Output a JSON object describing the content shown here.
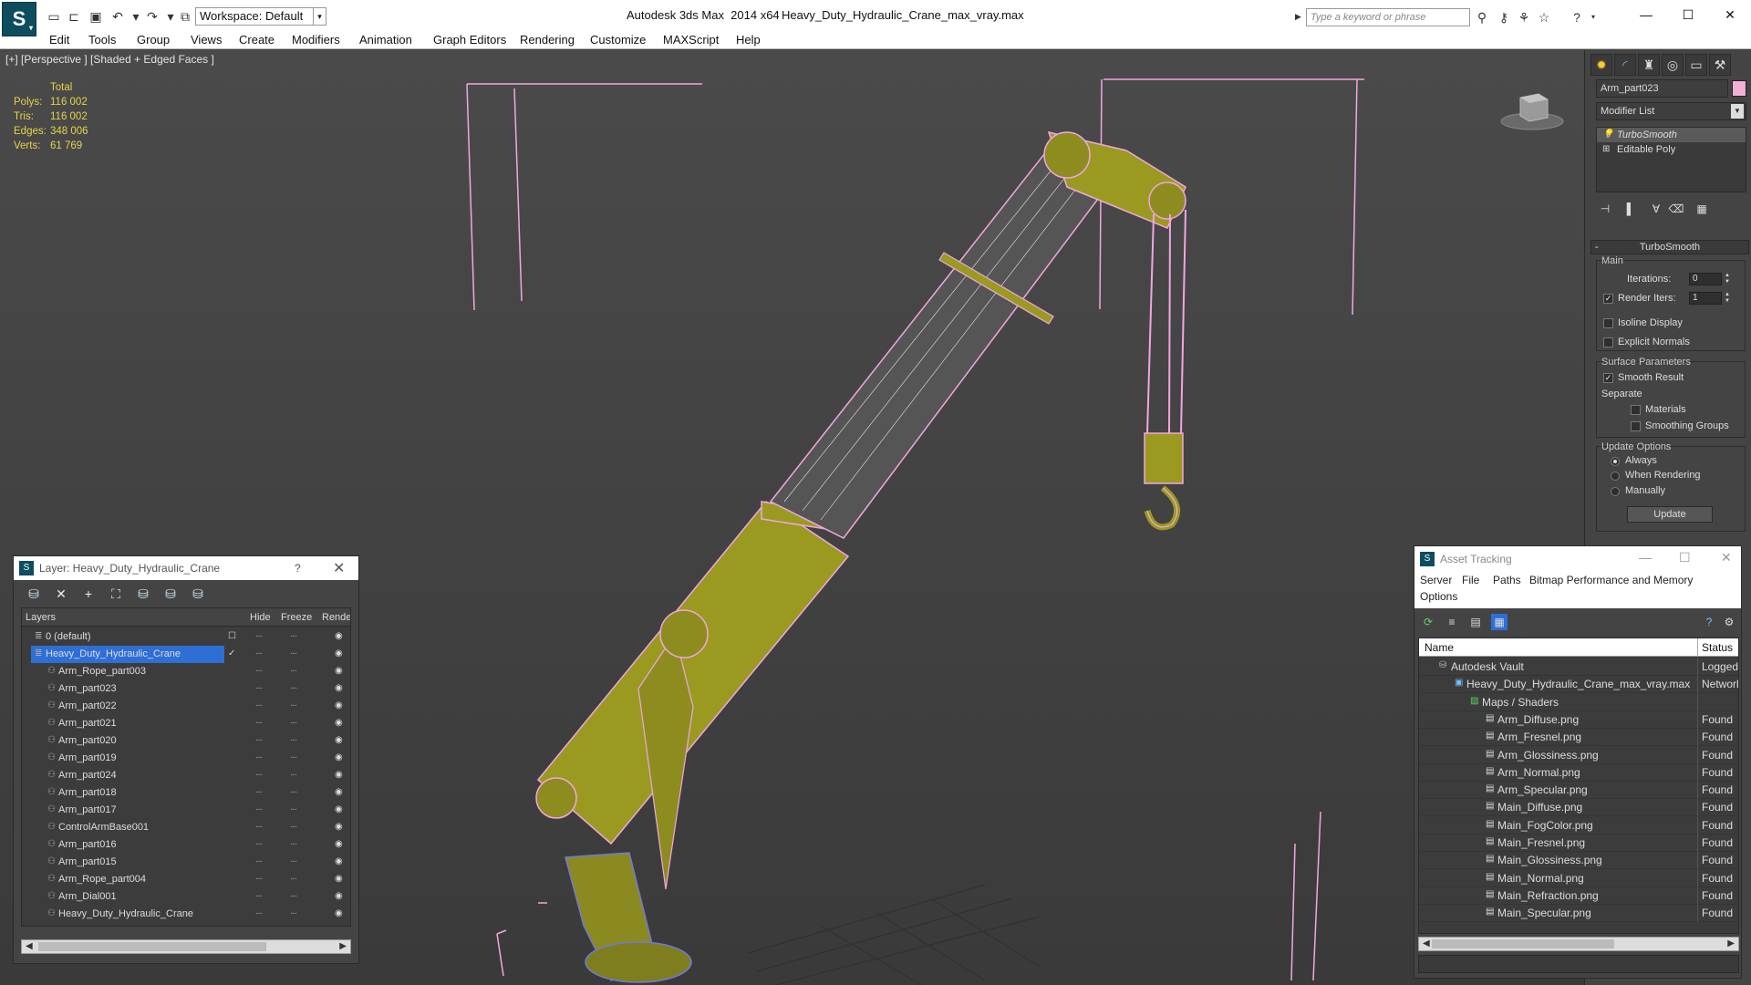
{
  "titlebar": {
    "workspace": "Workspace: Default",
    "app_title": "Autodesk 3ds Max  2014 x64",
    "file_title": "Heavy_Duty_Hydraulic_Crane_max_vray.max",
    "search_placeholder": "Type a keyword or phrase"
  },
  "menu": [
    "Edit",
    "Tools",
    "Group",
    "Views",
    "Create",
    "Modifiers",
    "Animation",
    "Graph Editors",
    "Rendering",
    "Customize",
    "MAXScript",
    "Help"
  ],
  "viewport": {
    "label": "[+] [Perspective ] [Shaded + Edged Faces ]",
    "stats": {
      "header": "Total",
      "rows": [
        {
          "label": "Polys:",
          "value": "116 002"
        },
        {
          "label": "Tris:",
          "value": "116 002"
        },
        {
          "label": "Edges:",
          "value": "348 006"
        },
        {
          "label": "Verts:",
          "value": "61 769"
        }
      ]
    }
  },
  "command_panel": {
    "object_name": "Arm_part023",
    "object_color": "#f0b0d8",
    "modifier_list": "Modifier List",
    "stack": [
      "TurboSmooth",
      "Editable Poly"
    ],
    "rollout": "TurboSmooth",
    "main_group": "Main",
    "iterations_label": "Iterations:",
    "iterations_value": "0",
    "render_iters_label": "Render Iters:",
    "render_iters_value": "1",
    "isoline": "Isoline Display",
    "explicit_normals": "Explicit Normals",
    "surface_group": "Surface Parameters",
    "smooth_result": "Smooth Result",
    "separate": "Separate",
    "materials": "Materials",
    "smoothing_groups": "Smoothing Groups",
    "update_group": "Update Options",
    "always": "Always",
    "when_rendering": "When Rendering",
    "manually": "Manually",
    "update_button": "Update"
  },
  "layer_window": {
    "title": "Layer: Heavy_Duty_Hydraulic_Crane",
    "help": "?",
    "columns": {
      "layers": "Layers",
      "hide": "Hide",
      "freeze": "Freeze",
      "render": "Rende"
    },
    "rows": [
      {
        "name": "0 (default)",
        "indent": 0
      },
      {
        "name": "Heavy_Duty_Hydraulic_Crane",
        "indent": 0
      },
      {
        "name": "Arm_Rope_part003",
        "indent": 1
      },
      {
        "name": "Arm_part023",
        "indent": 1
      },
      {
        "name": "Arm_part022",
        "indent": 1
      },
      {
        "name": "Arm_part021",
        "indent": 1
      },
      {
        "name": "Arm_part020",
        "indent": 1
      },
      {
        "name": "Arm_part019",
        "indent": 1
      },
      {
        "name": "Arm_part024",
        "indent": 1
      },
      {
        "name": "Arm_part018",
        "indent": 1
      },
      {
        "name": "Arm_part017",
        "indent": 1
      },
      {
        "name": "ControlArmBase001",
        "indent": 1
      },
      {
        "name": "Arm_part016",
        "indent": 1
      },
      {
        "name": "Arm_part015",
        "indent": 1
      },
      {
        "name": "Arm_Rope_part004",
        "indent": 1
      },
      {
        "name": "Arm_Dial001",
        "indent": 1
      },
      {
        "name": "Heavy_Duty_Hydraulic_Crane",
        "indent": 1
      }
    ]
  },
  "asset_window": {
    "title": "Asset Tracking",
    "menu": [
      "Server",
      "File",
      "Paths",
      "Bitmap Performance and Memory",
      "Options"
    ],
    "columns": {
      "name": "Name",
      "status": "Status"
    },
    "rows": [
      {
        "name": "Autodesk Vault",
        "status": "Logged",
        "indent": 0
      },
      {
        "name": "Heavy_Duty_Hydraulic_Crane_max_vray.max",
        "status": "Network",
        "indent": 1
      },
      {
        "name": "Maps / Shaders",
        "status": "",
        "indent": 2
      },
      {
        "name": "Arm_Diffuse.png",
        "status": "Found",
        "indent": 3
      },
      {
        "name": "Arm_Fresnel.png",
        "status": "Found",
        "indent": 3
      },
      {
        "name": "Arm_Glossiness.png",
        "status": "Found",
        "indent": 3
      },
      {
        "name": "Arm_Normal.png",
        "status": "Found",
        "indent": 3
      },
      {
        "name": "Arm_Specular.png",
        "status": "Found",
        "indent": 3
      },
      {
        "name": "Main_Diffuse.png",
        "status": "Found",
        "indent": 3
      },
      {
        "name": "Main_FogColor.png",
        "status": "Found",
        "indent": 3
      },
      {
        "name": "Main_Fresnel.png",
        "status": "Found",
        "indent": 3
      },
      {
        "name": "Main_Glossiness.png",
        "status": "Found",
        "indent": 3
      },
      {
        "name": "Main_Normal.png",
        "status": "Found",
        "indent": 3
      },
      {
        "name": "Main_Refraction.png",
        "status": "Found",
        "indent": 3
      },
      {
        "name": "Main_Specular.png",
        "status": "Found",
        "indent": 3
      }
    ]
  },
  "colors": {
    "wire": "#f2a6e0",
    "mesh": "#9a9a20",
    "selection": "#2e6fd6",
    "stats": "#e8d24a"
  }
}
